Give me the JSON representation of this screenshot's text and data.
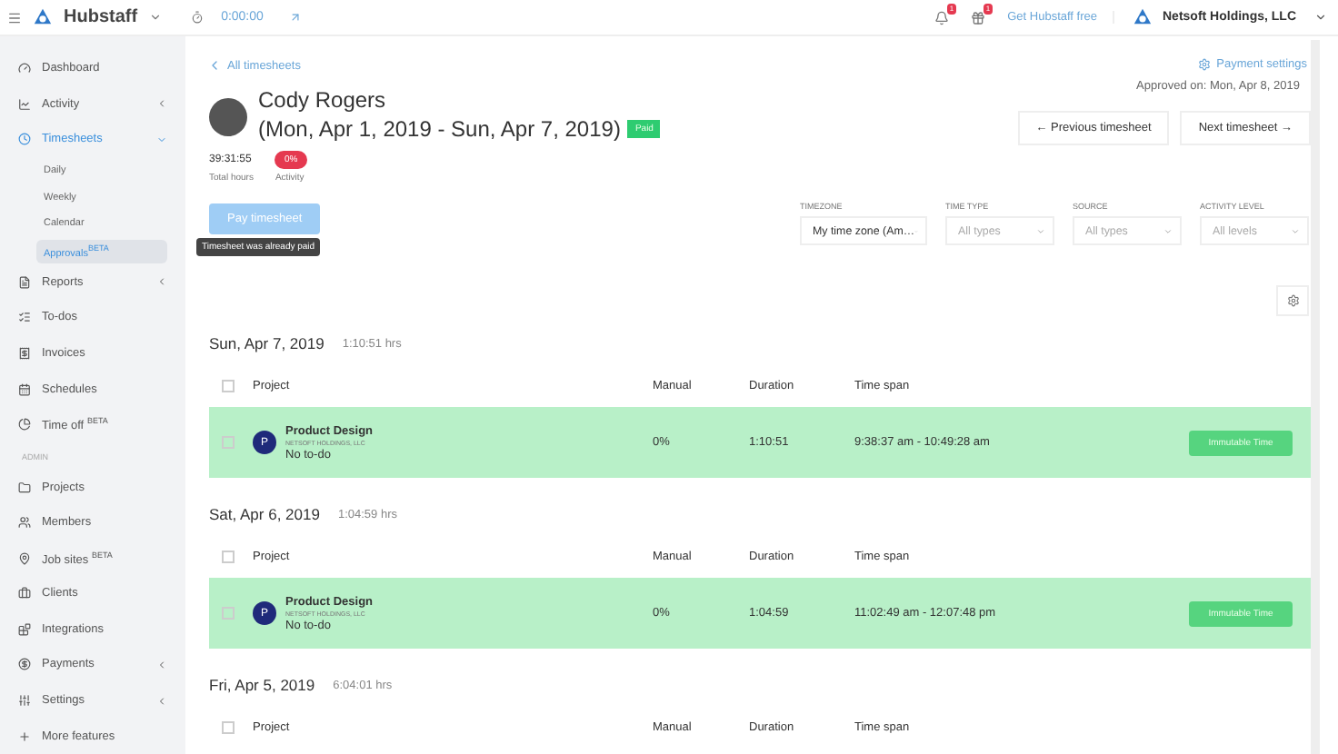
{
  "topbar": {
    "brand": "Hubstaff",
    "timer": "0:00:00",
    "notifications_badge": "1",
    "gifts_badge": "1",
    "promo_link": "Get Hubstaff free",
    "organization": "Netsoft Holdings, LLC"
  },
  "sidebar": {
    "items": [
      {
        "kind": "item",
        "label": "Dashboard",
        "selected": false
      },
      {
        "kind": "item",
        "label": "Activity",
        "selected": false,
        "expanded": false
      },
      {
        "kind": "item",
        "label": "Timesheets",
        "selected": true,
        "expanded": true,
        "children": [
          {
            "label": "Daily",
            "selected": false
          },
          {
            "label": "Weekly",
            "selected": false
          },
          {
            "label": "Calendar",
            "selected": false
          },
          {
            "label": "Approvals$^{BETA}$",
            "selected": true
          }
        ]
      },
      {
        "kind": "item",
        "label": "Reports",
        "selected": false,
        "expanded": false
      },
      {
        "kind": "item",
        "label": "To-dos",
        "selected": false
      },
      {
        "kind": "item",
        "label": "Invoices",
        "selected": false
      },
      {
        "kind": "item",
        "label": "Schedules",
        "selected": false
      },
      {
        "kind": "item",
        "label": "Time off $^{BETA}$",
        "selected": false
      },
      {
        "kind": "section",
        "label": "ADMIN"
      },
      {
        "kind": "item",
        "label": "Projects",
        "selected": false
      },
      {
        "kind": "item",
        "label": "Members",
        "selected": false
      },
      {
        "kind": "item",
        "label": "Job sites $^{BETA}$",
        "selected": false
      },
      {
        "kind": "item",
        "label": "Clients",
        "selected": false
      },
      {
        "kind": "item",
        "label": "Integrations",
        "selected": false
      },
      {
        "kind": "item",
        "label": "Payments",
        "selected": false,
        "expanded": false
      },
      {
        "kind": "item",
        "label": "Settings",
        "selected": false,
        "expanded": false
      },
      {
        "kind": "item",
        "label": "More features",
        "selected": false
      }
    ]
  },
  "header": {
    "back_link": "All timesheets",
    "payment_settings": "Payment settings",
    "name": "Cody Rogers",
    "period": "(Mon, Apr 1, 2019 - Sun, Apr 7, 2019)",
    "status": "Paid",
    "approved_on": "Approved on: Mon, Apr 8, 2019",
    "total_hours": "39:31:55",
    "total_hours_label": "Total hours",
    "activity": "0%",
    "activity_label": "Activity",
    "previous_button": "← Previous timesheet",
    "next_button": "Next timesheet →",
    "pay_button": "Pay timesheet",
    "pay_disabled": true,
    "tooltip": "Timesheet was already paid"
  },
  "filters": [
    {
      "label": "TIMEZONE",
      "value": "My time zone (Am…"
    },
    {
      "label": "TIME TYPE",
      "placeholder": "All types"
    },
    {
      "label": "SOURCE",
      "placeholder": "All types"
    },
    {
      "label": "ACTIVITY LEVEL",
      "placeholder": "All levels"
    }
  ],
  "days": [
    {
      "date": "Sun, Apr 7, 2019",
      "total": "1:10:51 hrs",
      "all_checked": false,
      "columns": [
        "Project",
        "Manual",
        "Duration",
        "Time span"
      ],
      "rows": [
        {
          "initial": "P",
          "project": "Product Design",
          "organization": "NETSOFT HOLDINGS, LLC",
          "todo": "No to-do",
          "manual": "0%",
          "duration": "1:10:51",
          "time_span": "9:38:37 am - 10:49:28 am",
          "action": "Immutable Time",
          "checked": false
        }
      ]
    },
    {
      "date": "Sat, Apr 6, 2019",
      "total": "1:04:59 hrs",
      "all_checked": false,
      "columns": [
        "Project",
        "Manual",
        "Duration",
        "Time span"
      ],
      "rows": [
        {
          "initial": "P",
          "project": "Product Design",
          "organization": "NETSOFT HOLDINGS, LLC",
          "todo": "No to-do",
          "manual": "0%",
          "duration": "1:04:59",
          "time_span": "11:02:49 am - 12:07:48 pm",
          "action": "Immutable Time",
          "checked": false
        }
      ]
    },
    {
      "date": "Fri, Apr 5, 2019",
      "total": "6:04:01 hrs",
      "all_checked": false,
      "columns": [
        "Project",
        "Manual",
        "Duration",
        "Time span"
      ]
    }
  ]
}
